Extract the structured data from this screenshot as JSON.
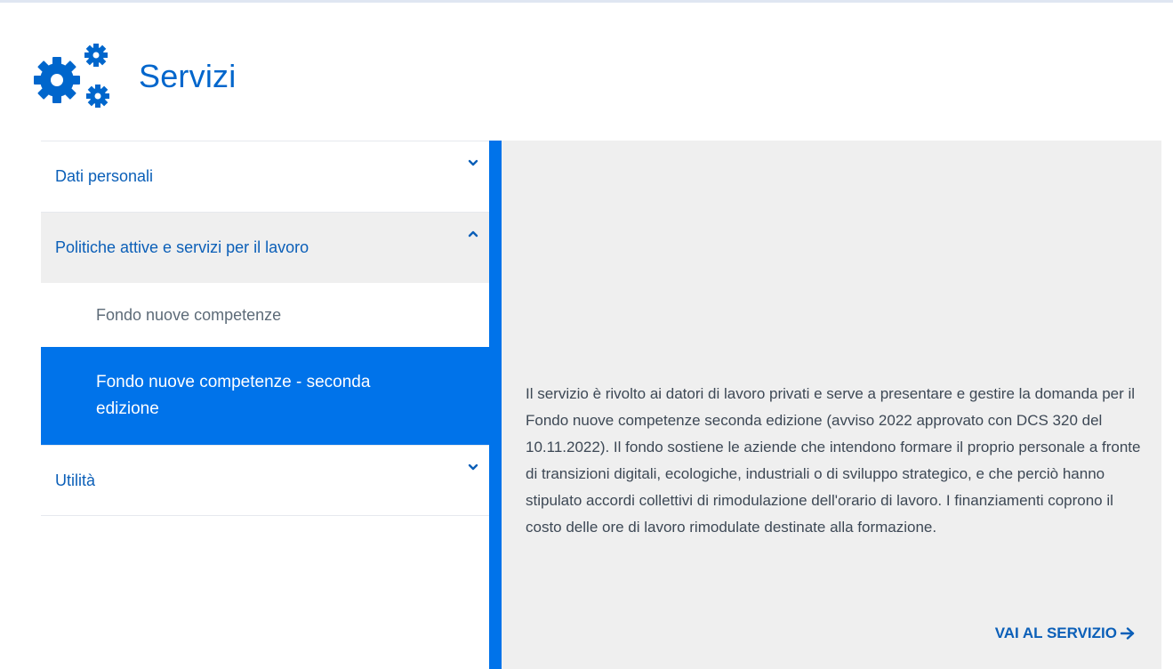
{
  "header": {
    "title": "Servizi",
    "icon": "gears-icon",
    "accent_color": "#0066cc"
  },
  "sidebar": {
    "items": [
      {
        "label": "Dati personali",
        "expanded": false
      },
      {
        "label": "Politiche attive e servizi per il lavoro",
        "expanded": true,
        "children": [
          {
            "label": "Fondo nuove competenze",
            "active": false
          },
          {
            "label": "Fondo nuove competenze - seconda edizione",
            "active": true
          }
        ]
      },
      {
        "label": "Utilità",
        "expanded": false
      }
    ],
    "active_color": "#0073ea"
  },
  "content": {
    "description": "Il servizio è rivolto ai datori di lavoro privati e serve a presentare e gestire la domanda per il Fondo nuove competenze seconda edizione (avviso 2022 approvato con DCS 320 del 10.11.2022). Il fondo sostiene le aziende che intendono formare il proprio personale a fronte di transizioni digitali, ecologiche, industriali o di sviluppo strategico, e che perciò hanno stipulato accordi collettivi di rimodulazione dell'orario di lavoro. I finanziamenti coprono il costo delle ore di lavoro rimodulate destinate alla formazione.",
    "cta_label": "VAI AL SERVIZIO",
    "cta_icon": "arrow-right-icon"
  }
}
